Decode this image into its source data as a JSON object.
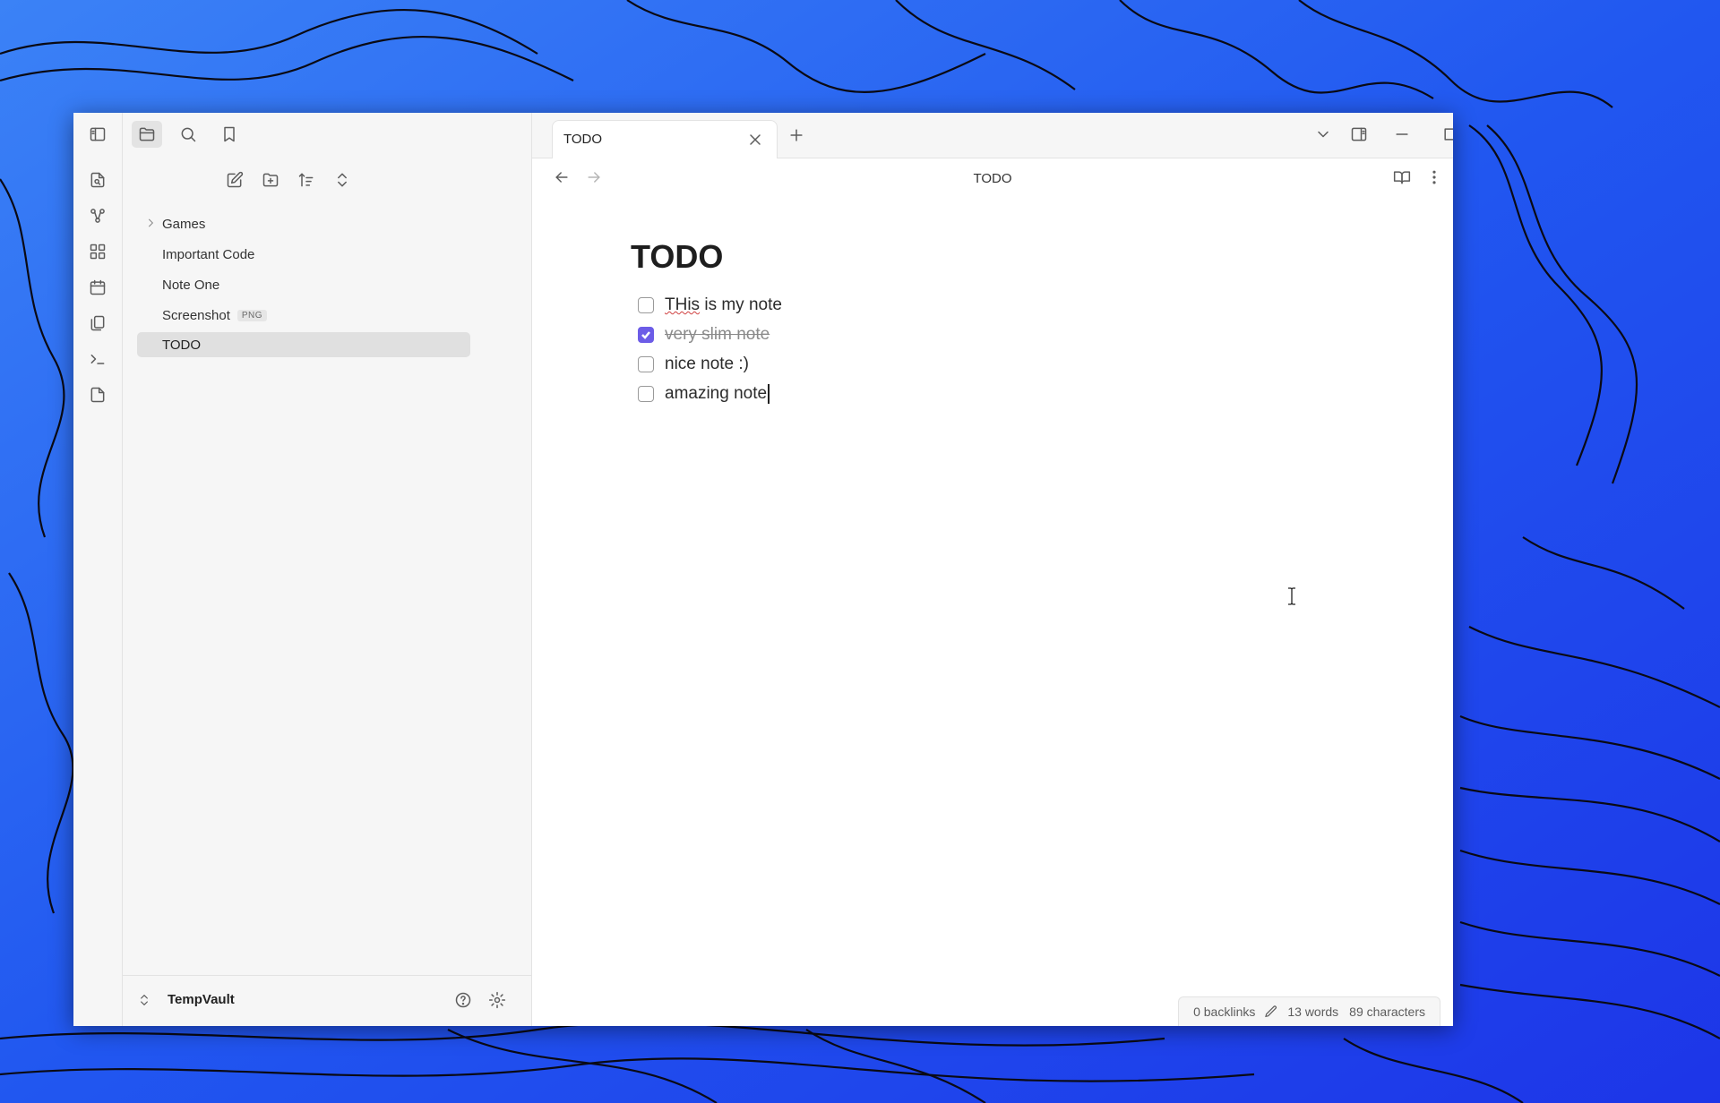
{
  "window": {
    "title": "TODO"
  },
  "ribbon": {
    "icons": [
      "open-quick-switcher-icon",
      "graph-view-icon",
      "canvas-icon",
      "daily-notes-icon",
      "templates-icon",
      "command-palette-icon",
      "new-note-icon"
    ]
  },
  "sidebar": {
    "tabs": [
      "files-tab",
      "search-tab",
      "bookmarks-tab"
    ],
    "actions": [
      "new-note",
      "new-folder",
      "sort",
      "collapse"
    ],
    "items": [
      {
        "label": "Games",
        "type": "folder"
      },
      {
        "label": "Important Code",
        "type": "file"
      },
      {
        "label": "Note One",
        "type": "file"
      },
      {
        "label": "Screenshot",
        "type": "file",
        "badge": "PNG"
      },
      {
        "label": "TODO",
        "type": "file",
        "active": true
      }
    ],
    "vault_name": "TempVault"
  },
  "tabs": [
    {
      "label": "TODO"
    }
  ],
  "view": {
    "header_title": "TODO",
    "doc_title": "TODO",
    "tasks": [
      {
        "text_a": "THis",
        "text_b": " is my note",
        "done": false
      },
      {
        "text": "very slim note",
        "done": true
      },
      {
        "text": "nice note :)",
        "done": false
      },
      {
        "text": "amazing note",
        "done": false
      }
    ]
  },
  "status_bar": {
    "backlinks": "0 backlinks",
    "words": "13 words",
    "characters": "89 characters"
  },
  "colors": {
    "accent": "#6c5ce7",
    "wallpaper": "#2a6cf0"
  }
}
